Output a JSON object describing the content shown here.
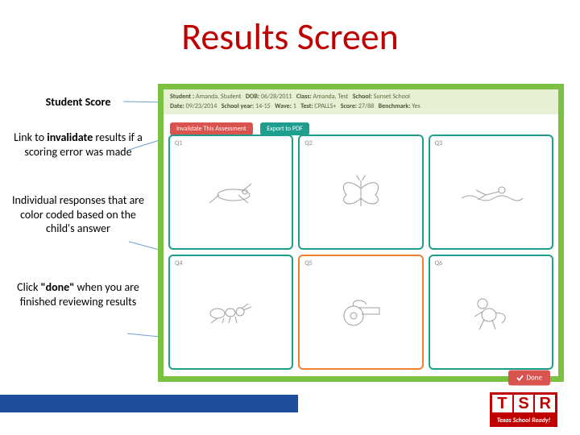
{
  "title": "Results Screen",
  "side": {
    "score": "Student Score",
    "invalidate_pre": "Link to ",
    "invalidate_bold": "invalidate",
    "invalidate_post": " results if a scoring error was made",
    "responses": "Individual responses that are color coded based on the child's answer",
    "done_pre": "Click ",
    "done_q": "\"done\"",
    "done_post": " when you are finished reviewing results"
  },
  "header": {
    "student_label": "Student :",
    "student": "Amanda, Student",
    "dob_label": "DOB:",
    "dob": "06/28/2011",
    "class_label": "Class:",
    "class": "Amanda, Test",
    "school_label": "School:",
    "school": "Sunset School",
    "date_label": "Date:",
    "date": "09/23/2014",
    "year_label": "School year:",
    "year": "14-15",
    "wave_label": "Wave:",
    "wave": "1",
    "test_label": "Test:",
    "test": "CPALLS+",
    "score_label": "Score:",
    "score": "27/88",
    "bench_label": "Benchmark:",
    "bench": "Yes"
  },
  "buttons": {
    "invalidate": "Invalidate This Assessment",
    "export": "Export to PDF",
    "done": "Done"
  },
  "cards": [
    {
      "q": "Q1",
      "item": "grasshopper",
      "state": "teal"
    },
    {
      "q": "Q2",
      "item": "butterfly",
      "state": "teal"
    },
    {
      "q": "Q3",
      "item": "swimmer",
      "state": "teal"
    },
    {
      "q": "Q4",
      "item": "ant",
      "state": "teal"
    },
    {
      "q": "Q5",
      "item": "whistle",
      "state": "orange"
    },
    {
      "q": "Q6",
      "item": "monkey",
      "state": "teal"
    }
  ],
  "logo": {
    "letters": [
      "T",
      "S",
      "R"
    ],
    "sub": "Texas School Ready!"
  }
}
